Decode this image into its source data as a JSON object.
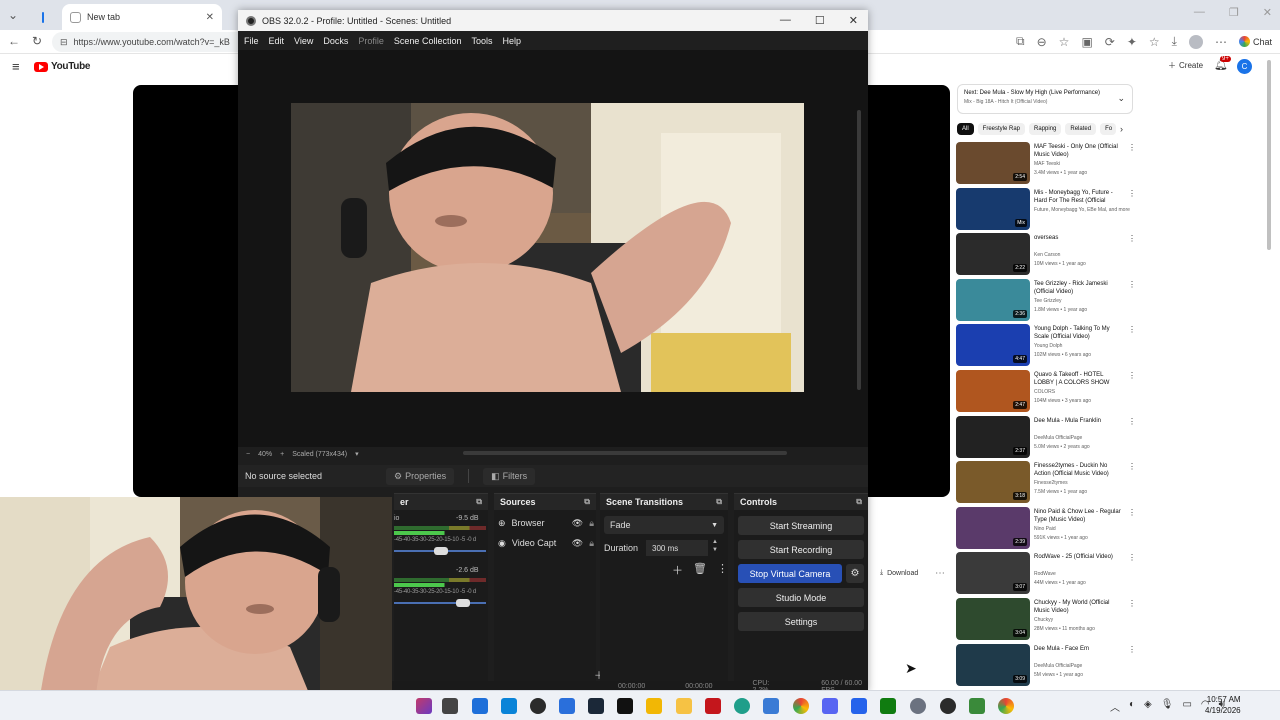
{
  "browser": {
    "tabs": [
      {
        "label": "New tab",
        "close": "✕"
      }
    ],
    "url": "https://www.youtube.com/watch?v=_kB",
    "chat_label": "Chat"
  },
  "youtube": {
    "logo_text": "YouTube",
    "create_label": "Create",
    "notification_count": "9+",
    "avatar_letter": "C",
    "playlist": {
      "title": "Next: Dee Mula - Slow My High (Live Performance)",
      "subtitle": "Mix - Big 18A - Hitch It (Official Video)"
    },
    "chips": [
      "All",
      "Freestyle Rap",
      "Rapping",
      "Related",
      "Fo"
    ],
    "download_label": "Download",
    "recommendations": [
      {
        "title": "MAF Teeski - Only One (Official Music Video)",
        "channel": "MAF Teeski",
        "meta": "3.4M views • 1 year ago",
        "duration": "2:54",
        "color": "#6a4a2e"
      },
      {
        "title": "Mis - Moneybagg Yo, Future - Hard For The Rest (Official Music...",
        "channel": "Future, Moneybagg Yo, EBe Mal, and more",
        "meta": "",
        "duration": "Mix",
        "color": "#173a6e"
      },
      {
        "title": "overseas",
        "channel": "Ken Carson",
        "meta": "10M views • 1 year ago",
        "duration": "2:22",
        "color": "#2b2b2b"
      },
      {
        "title": "Tee Grizzley - Rick Jameski (Official Video)",
        "channel": "Tee Grizzley",
        "meta": "1.8M views • 1 year ago",
        "duration": "2:36",
        "color": "#3a8a9a"
      },
      {
        "title": "Young Dolph - Talking To My Scale (Official Video)",
        "channel": "Young Dolph",
        "meta": "102M views • 6 years ago",
        "duration": "4:47",
        "color": "#1b3fb0"
      },
      {
        "title": "Quavo & Takeoff - HOTEL LOBBY | A COLORS SHOW",
        "channel": "COLORS",
        "meta": "104M views • 3 years ago",
        "duration": "2:47",
        "color": "#b0561f"
      },
      {
        "title": "Dee Mula - Mula Franklin",
        "channel": "DeeMula OfficialPage",
        "meta": "5.0M views • 2 years ago",
        "duration": "2:37",
        "color": "#222222"
      },
      {
        "title": "Finesse2tymes - Duckin No Action (Official Music Video)",
        "channel": "Finesse2tymes",
        "meta": "7.5M views • 1 year ago",
        "duration": "3:18",
        "color": "#7a5a2a"
      },
      {
        "title": "Nino Paid & Chow Lee - Regular Type (Music Video)",
        "channel": "Nino Paid",
        "meta": "591K views • 1 year ago",
        "duration": "2:39",
        "color": "#5a3a6a"
      },
      {
        "title": "RodWave - 25 (Official Video)",
        "channel": "RodWave",
        "meta": "44M views • 1 year ago",
        "duration": "3:07",
        "color": "#3a3a3a"
      },
      {
        "title": "Chuckyy - My World (Official Music Video)",
        "channel": "Chuckyy",
        "meta": "28M views • 11 months ago",
        "duration": "3:04",
        "color": "#2e4a2e"
      },
      {
        "title": "Dee Mula - Face Em",
        "channel": "DeeMula OfficialPage",
        "meta": "5M views • 1 year ago",
        "duration": "3:09",
        "color": "#1f3a4a"
      }
    ]
  },
  "obs": {
    "title": "OBS 32.0.2 - Profile: Untitled - Scenes: Untitled",
    "menu": [
      "File",
      "Edit",
      "View",
      "Docks",
      "Profile",
      "Scene Collection",
      "Tools",
      "Help"
    ],
    "zoom": {
      "percent": "40%",
      "scaled": "Scaled (773x434)"
    },
    "no_source": "No source selected",
    "properties_label": "Properties",
    "filters_label": "Filters",
    "mixer": {
      "title": "er",
      "channels": [
        {
          "name": "io",
          "db": "-9.5 dB"
        },
        {
          "name": "",
          "db": "-2.6 dB"
        }
      ],
      "ticks": "-45-40-35-30-25-20-15-10 -5 -0  d"
    },
    "sources": {
      "title": "Sources",
      "items": [
        {
          "label": "Browser"
        },
        {
          "label": "Video Capt"
        }
      ]
    },
    "transitions": {
      "title": "Scene Transitions",
      "selected": "Fade",
      "duration_label": "Duration",
      "duration_value": "300 ms"
    },
    "controls": {
      "title": "Controls",
      "buttons": [
        "Start Streaming",
        "Start Recording",
        "Stop Virtual Camera",
        "Studio Mode",
        "Settings"
      ]
    },
    "status": {
      "time1": "00:00:00",
      "time2": "00:00:00",
      "cpu": "CPU: 2.2%",
      "fps": "60.00 / 60.00 FPS"
    }
  },
  "taskbar": {
    "time": "10:57 AM",
    "date": "4/19/2026"
  }
}
